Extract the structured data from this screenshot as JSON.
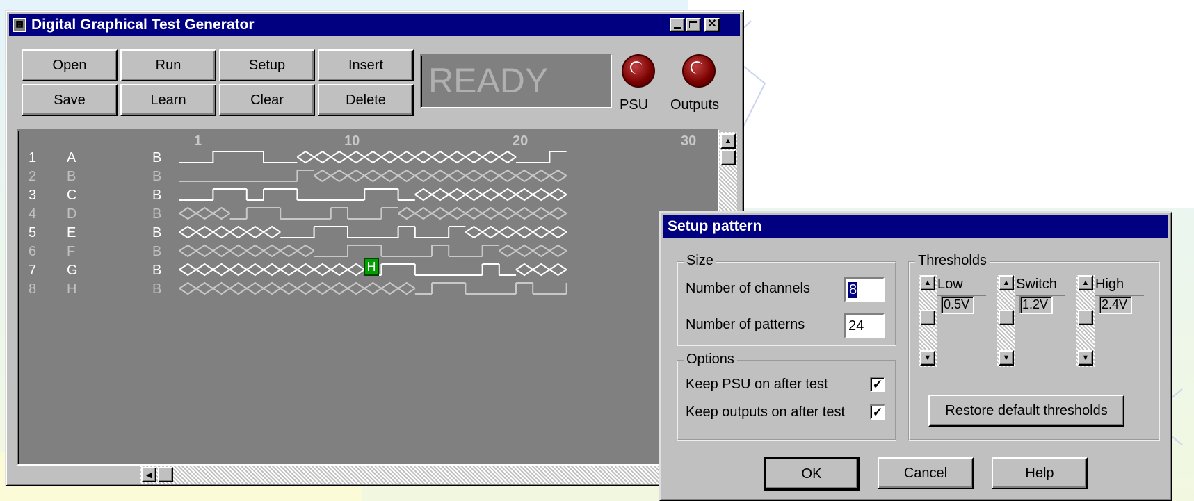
{
  "main_window": {
    "title": "Digital Graphical Test Generator",
    "buttons": {
      "open": "Open",
      "run": "Run",
      "setup": "Setup",
      "insert": "Insert",
      "save": "Save",
      "learn": "Learn",
      "clear": "Clear",
      "delete": "Delete"
    },
    "status": "READY",
    "indicators": {
      "psu": "PSU",
      "outputs": "Outputs",
      "led_color": "#8b0000"
    },
    "ruler": [
      "1",
      "10",
      "20",
      "30"
    ],
    "channels": [
      {
        "num": "1",
        "name": "A",
        "type": "B",
        "active": true
      },
      {
        "num": "2",
        "name": "B",
        "type": "B",
        "active": false
      },
      {
        "num": "3",
        "name": "C",
        "type": "B",
        "active": true
      },
      {
        "num": "4",
        "name": "D",
        "type": "B",
        "active": false
      },
      {
        "num": "5",
        "name": "E",
        "type": "B",
        "active": true
      },
      {
        "num": "6",
        "name": "F",
        "type": "B",
        "active": false
      },
      {
        "num": "7",
        "name": "G",
        "type": "B",
        "active": true
      },
      {
        "num": "8",
        "name": "H",
        "type": "B",
        "active": false
      }
    ],
    "cursor": {
      "label": "H",
      "color": "#00a000"
    },
    "colors": {
      "title_bar": "#000080",
      "canvas": "#808080",
      "active_text": "#ffffff",
      "inactive_text": "#c0c0c0"
    }
  },
  "dialog": {
    "title": "Setup pattern",
    "size_group": "Size",
    "channels_label": "Number of channels",
    "channels_value": "8",
    "patterns_label": "Number of patterns",
    "patterns_value": "24",
    "options_group": "Options",
    "keep_psu": "Keep PSU on after test",
    "keep_outputs": "Keep outputs on after test",
    "check_mark": "✓",
    "thresholds_group": "Thresholds",
    "thresholds": [
      {
        "name": "Low",
        "value": "0.5V"
      },
      {
        "name": "Switch",
        "value": "1.2V"
      },
      {
        "name": "High",
        "value": "2.4V"
      }
    ],
    "restore": "Restore default thresholds",
    "ok": "OK",
    "cancel": "Cancel",
    "help": "Help"
  }
}
